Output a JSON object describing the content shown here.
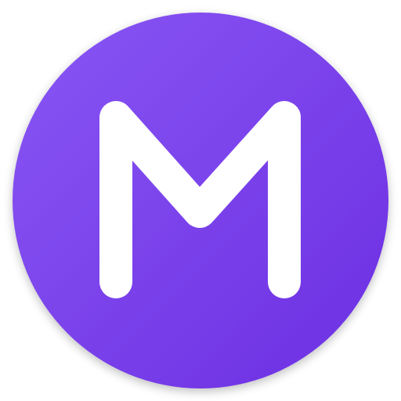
{
  "icon": {
    "name": "m-logo-icon",
    "letter": "M",
    "colors": {
      "gradient_start": "#8957F4",
      "gradient_end": "#6C2EE2",
      "letter": "#FFFFFF",
      "background": "#FFFFFF"
    }
  }
}
